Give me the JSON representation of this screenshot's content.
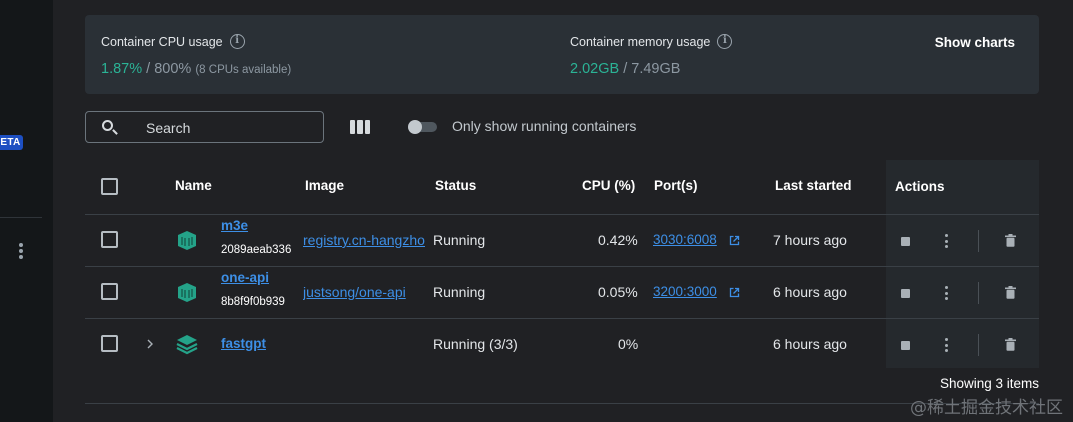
{
  "sidebar": {
    "badge": "ETA",
    "more_icon": "kebab-vertical-icon"
  },
  "usage": {
    "cpu": {
      "label": "Container CPU usage",
      "used": "1.87%",
      "total": "800%",
      "note": "(8 CPUs available)"
    },
    "memory": {
      "label": "Container memory usage",
      "used": "2.02GB",
      "total": "7.49GB"
    },
    "separator": " / ",
    "show_charts_label": "Show charts",
    "info_icon_glyph": "i"
  },
  "toolbar": {
    "search_placeholder": "Search",
    "toggle_label": "Only show running containers",
    "toggle_on": false
  },
  "table": {
    "columns": {
      "name": "Name",
      "image": "Image",
      "status": "Status",
      "cpu": "CPU (%)",
      "ports": "Port(s)",
      "last_started": "Last started",
      "actions": "Actions"
    },
    "rows": [
      {
        "name": "m3e",
        "id": "2089aeab336",
        "image": "registry.cn-hangzhou",
        "status": "Running",
        "cpu": "0.42%",
        "port": "3030:6008",
        "last_started": "7 hours ago",
        "icon": "container-icon"
      },
      {
        "name": "one-api",
        "id": "8b8f9f0b939",
        "image": "justsong/one-api",
        "status": "Running",
        "cpu": "0.05%",
        "port": "3200:3000",
        "last_started": "6 hours ago",
        "icon": "container-icon"
      },
      {
        "name": "fastgpt",
        "id": "",
        "image": "",
        "status": "Running (3/3)",
        "cpu": "0%",
        "port": "",
        "last_started": "6 hours ago",
        "icon": "compose-stack-icon"
      }
    ]
  },
  "footer": {
    "count_text": "Showing 3 items"
  },
  "watermark": "@稀土掘金技术社区",
  "colors": {
    "accent_green": "#2bb396",
    "link_blue": "#3d8fe6",
    "badge_blue": "#1d4fc2",
    "background": "#202124",
    "card": "#2a3036"
  }
}
